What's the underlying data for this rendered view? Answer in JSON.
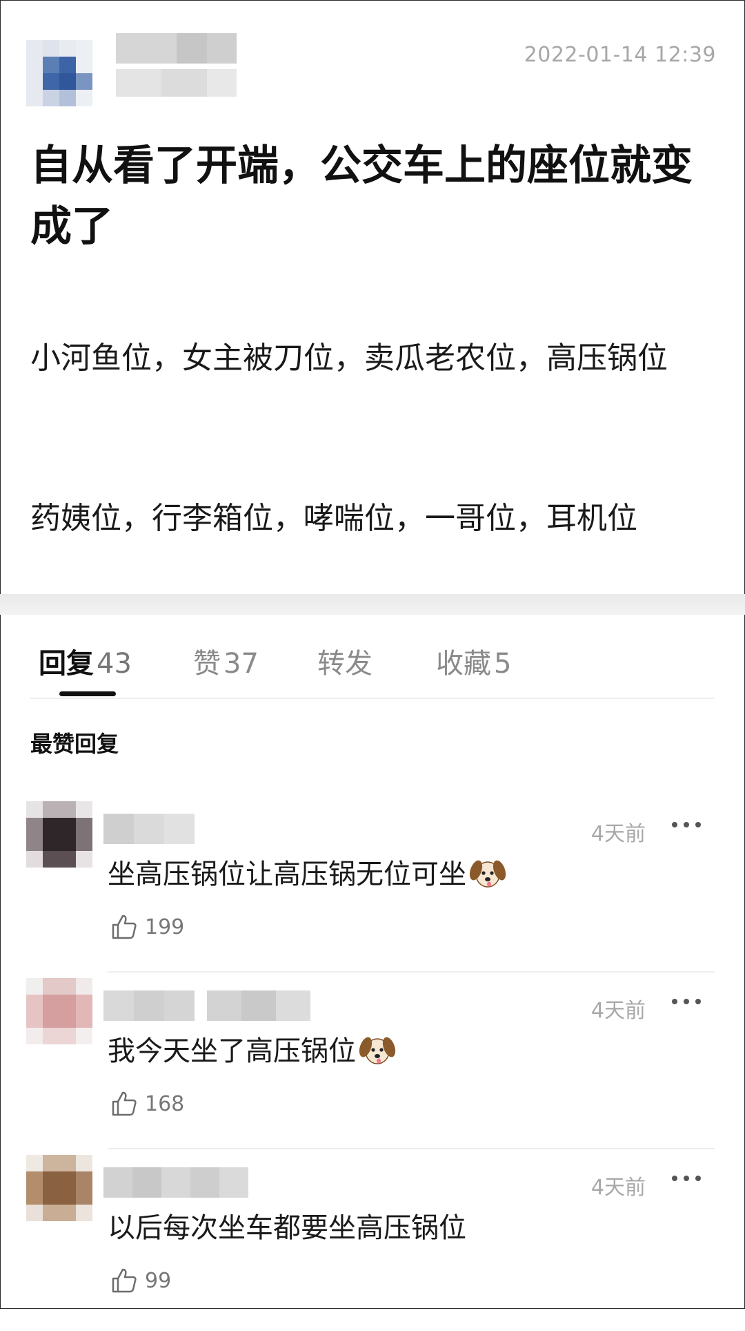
{
  "post": {
    "timestamp": "2022-01-14 12:39",
    "title": "自从看了开端，公交车上的座位就变成了",
    "body": [
      "小河鱼位，女主被刀位，卖瓜老农位，高压锅位",
      "药姨位，行李箱位，哮喘位，一哥位，耳机位"
    ]
  },
  "tabs": [
    {
      "label": "回复",
      "count": "43",
      "active": true
    },
    {
      "label": "赞",
      "count": "37",
      "active": false
    },
    {
      "label": "转发",
      "count": "",
      "active": false
    },
    {
      "label": "收藏",
      "count": "5",
      "active": false
    }
  ],
  "section_title": "最赞回复",
  "comments": [
    {
      "time": "4天前",
      "text": "坐高压锅位让高压锅无位可坐",
      "emoji": "dog-face-emoji",
      "likes": "199"
    },
    {
      "time": "4天前",
      "text": "我今天坐了高压锅位",
      "emoji": "dog-face-emoji",
      "likes": "168"
    },
    {
      "time": "4天前",
      "text": "以后每次坐车都要坐高压锅位",
      "emoji": "",
      "likes": "99"
    }
  ],
  "colors": {
    "text": "#111111",
    "muted": "#a7a7a7",
    "divider": "#e9e9e9",
    "active_tab": "#111111"
  }
}
